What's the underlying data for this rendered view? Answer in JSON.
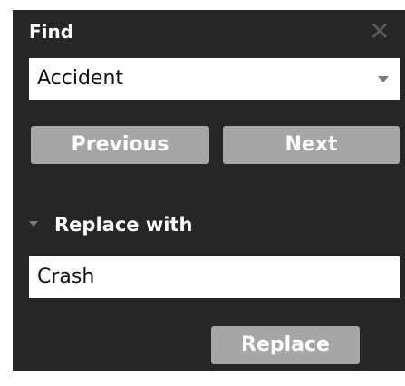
{
  "find": {
    "title": "Find",
    "close_icon": "close-icon",
    "value": "Accident",
    "previous_label": "Previous",
    "next_label": "Next"
  },
  "replace": {
    "section_label": "Replace with",
    "value": "Crash",
    "button_label": "Replace"
  },
  "colors": {
    "panel_bg": "#262626",
    "button_bg": "#a6a6a6",
    "field_bg": "#ffffff"
  }
}
